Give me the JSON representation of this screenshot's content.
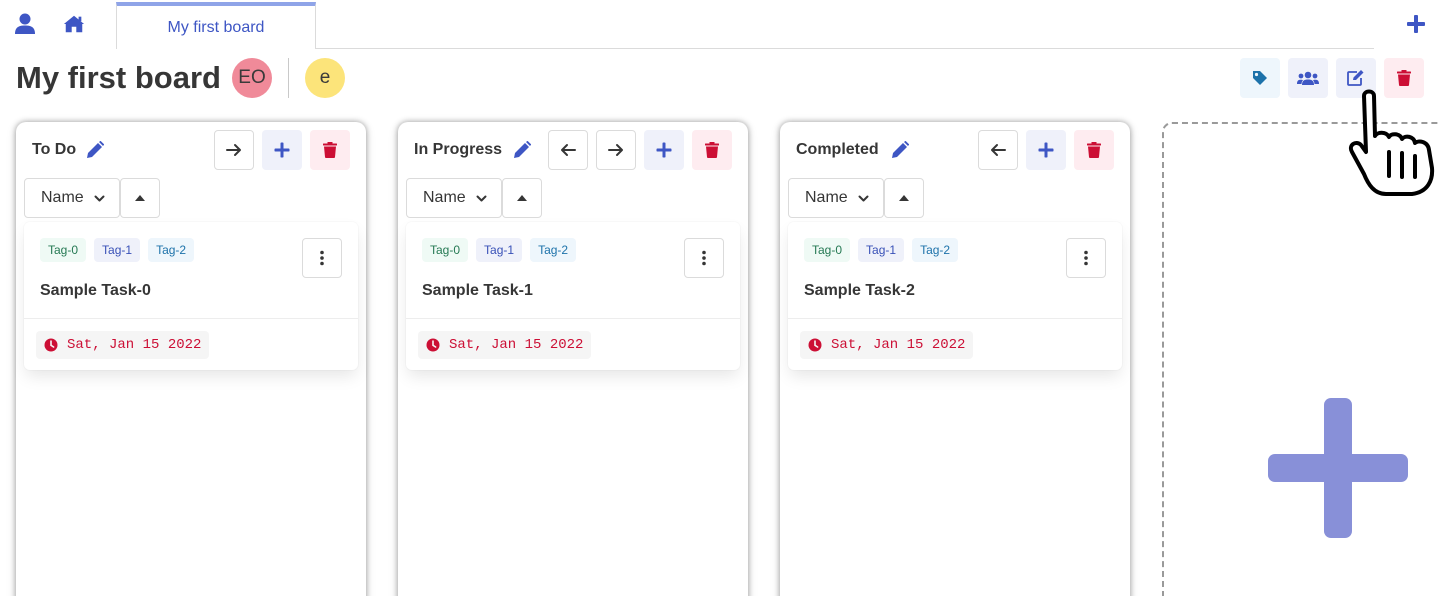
{
  "nav": {
    "user_icon": "user-icon",
    "home_icon": "home-icon",
    "tab_label": "My first board",
    "add_board_icon": "plus-icon"
  },
  "board": {
    "title": "My first board",
    "members": [
      {
        "initials": "EO",
        "color": "#f08a99"
      },
      {
        "initials": "e",
        "color": "#fce47a"
      }
    ],
    "actions": [
      "tag-icon",
      "users-icon",
      "edit-icon",
      "trash-icon"
    ]
  },
  "colors": {
    "primary": "#3e56c4",
    "danger": "#cc0f35",
    "add_column_plus": "#8890d8"
  },
  "columns": [
    {
      "title": "To Do",
      "sort": {
        "selected": "Name"
      },
      "buttons": [
        "arrow-right-icon",
        "plus-icon",
        "trash-icon"
      ],
      "card": {
        "tags": [
          "Tag-0",
          "Tag-1",
          "Tag-2"
        ],
        "title": "Sample Task-0",
        "due": "Sat, Jan 15 2022"
      }
    },
    {
      "title": "In Progress",
      "sort": {
        "selected": "Name"
      },
      "buttons": [
        "arrow-left-icon",
        "arrow-right-icon",
        "plus-icon",
        "trash-icon"
      ],
      "card": {
        "tags": [
          "Tag-0",
          "Tag-1",
          "Tag-2"
        ],
        "title": "Sample Task-1",
        "due": "Sat, Jan 15 2022"
      }
    },
    {
      "title": "Completed",
      "sort": {
        "selected": "Name"
      },
      "buttons": [
        "arrow-left-icon",
        "plus-icon",
        "trash-icon"
      ],
      "card": {
        "tags": [
          "Tag-0",
          "Tag-1",
          "Tag-2"
        ],
        "title": "Sample Task-2",
        "due": "Sat, Jan 15 2022"
      }
    }
  ]
}
